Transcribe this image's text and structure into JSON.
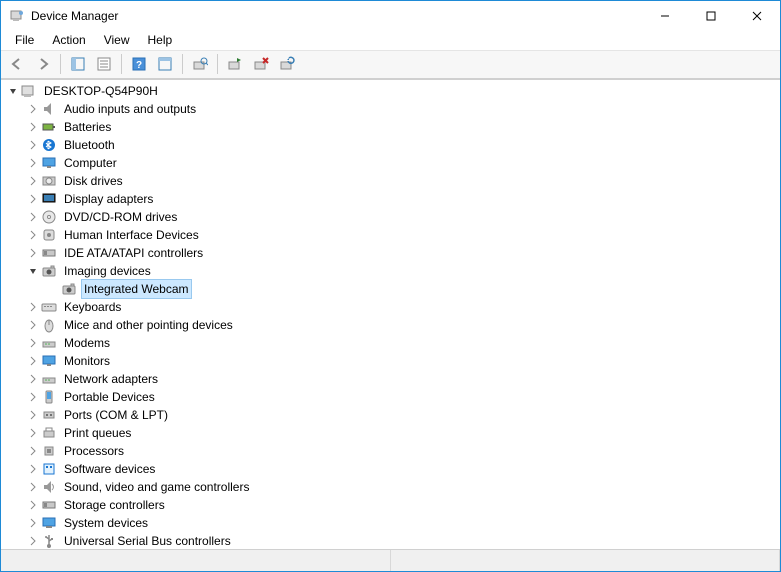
{
  "window": {
    "title": "Device Manager"
  },
  "menu": {
    "file": "File",
    "action": "Action",
    "view": "View",
    "help": "Help"
  },
  "tree": {
    "root": "DESKTOP-Q54P90H",
    "categories": [
      {
        "label": "Audio inputs and outputs",
        "icon": "audio"
      },
      {
        "label": "Batteries",
        "icon": "battery"
      },
      {
        "label": "Bluetooth",
        "icon": "bluetooth"
      },
      {
        "label": "Computer",
        "icon": "computer"
      },
      {
        "label": "Disk drives",
        "icon": "disk"
      },
      {
        "label": "Display adapters",
        "icon": "display"
      },
      {
        "label": "DVD/CD-ROM drives",
        "icon": "dvd"
      },
      {
        "label": "Human Interface Devices",
        "icon": "hid"
      },
      {
        "label": "IDE ATA/ATAPI controllers",
        "icon": "ide"
      },
      {
        "label": "Imaging devices",
        "icon": "imaging",
        "expanded": true,
        "children": [
          {
            "label": "Integrated Webcam",
            "icon": "webcam",
            "selected": true
          }
        ]
      },
      {
        "label": "Keyboards",
        "icon": "keyboard"
      },
      {
        "label": "Mice and other pointing devices",
        "icon": "mouse"
      },
      {
        "label": "Modems",
        "icon": "modem"
      },
      {
        "label": "Monitors",
        "icon": "monitor"
      },
      {
        "label": "Network adapters",
        "icon": "network"
      },
      {
        "label": "Portable Devices",
        "icon": "portable"
      },
      {
        "label": "Ports (COM & LPT)",
        "icon": "port"
      },
      {
        "label": "Print queues",
        "icon": "printer"
      },
      {
        "label": "Processors",
        "icon": "cpu"
      },
      {
        "label": "Software devices",
        "icon": "software"
      },
      {
        "label": "Sound, video and game controllers",
        "icon": "sound"
      },
      {
        "label": "Storage controllers",
        "icon": "storage"
      },
      {
        "label": "System devices",
        "icon": "system"
      },
      {
        "label": "Universal Serial Bus controllers",
        "icon": "usb"
      }
    ]
  }
}
